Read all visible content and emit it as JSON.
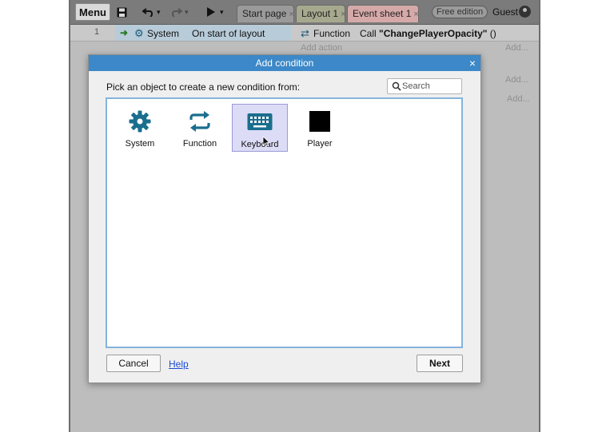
{
  "toolbar": {
    "menu_label": "Menu",
    "tabs": [
      {
        "label": "Start page",
        "close": "×"
      },
      {
        "label": "Layout 1",
        "close": "×"
      },
      {
        "label": "Event sheet 1",
        "close": "×"
      }
    ],
    "edition_badge": "Free edition",
    "user_label": "Guest"
  },
  "event_sheet": {
    "row_number": "1",
    "condition": {
      "object": "System",
      "text": "On start of layout"
    },
    "action": {
      "object": "Function",
      "text_prefix": "Call ",
      "function_name": "\"ChangePlayerOpacity\"",
      "text_suffix": " ()"
    },
    "add_action": "Add action",
    "add_labels": [
      "Add...",
      "Add...",
      "Add..."
    ]
  },
  "dialog": {
    "title": "Add condition",
    "close": "×",
    "prompt": "Pick an object to create a new condition from:",
    "search": {
      "placeholder": "Search",
      "value": ""
    },
    "objects": [
      {
        "label": "System",
        "icon": "gear-icon",
        "selected": false
      },
      {
        "label": "Function",
        "icon": "function-icon",
        "selected": false
      },
      {
        "label": "Keyboard",
        "icon": "keyboard-icon",
        "selected": true
      },
      {
        "label": "Player",
        "icon": "black-square-sprite",
        "selected": false
      }
    ],
    "buttons": {
      "cancel": "Cancel",
      "help": "Help",
      "next": "Next"
    }
  },
  "colors": {
    "title_bar": "#3c88c8",
    "icon_teal": "#1a6e8e",
    "selected_bg": "#dcdcf6",
    "link": "#1a4ad8"
  }
}
